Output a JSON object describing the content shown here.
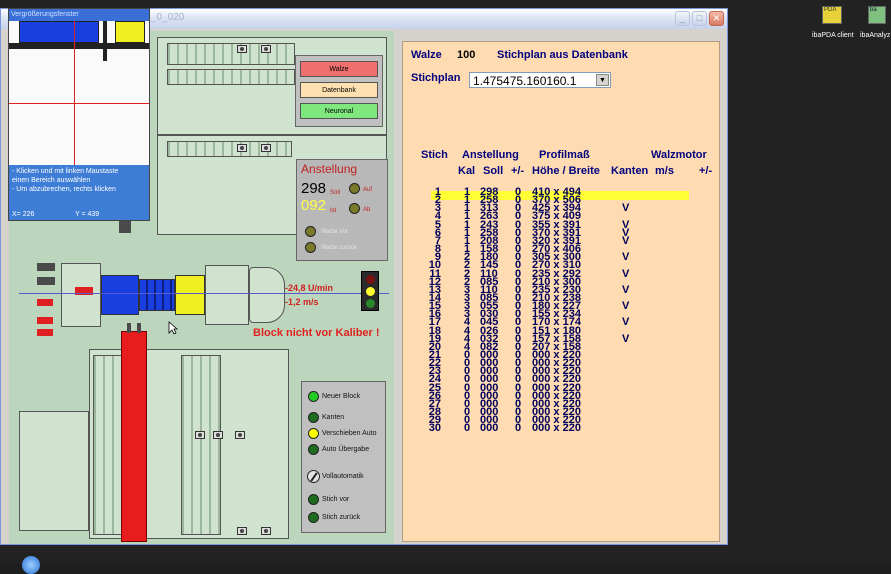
{
  "window": {
    "title": "_0_020",
    "minimize_glyph": "_",
    "maximize_glyph": "□",
    "close_glyph": "✕"
  },
  "magnifier": {
    "title": "Vergrößerungsfenster",
    "instructions": [
      "- Klicken und mit linken Maustaste",
      "  einen Bereich auswählen",
      "- Um abzubrechen, rechts klicken"
    ],
    "x_readout": "X= 226",
    "y_readout": "Y = 439"
  },
  "mode_buttons": {
    "walze": "Walze",
    "datenbank": "Datenbank",
    "neuronal": "Neuronal",
    "colors": {
      "walze": "#ef6f6f",
      "datenbank": "#ffe0b0",
      "neuronal": "#7ee87e"
    }
  },
  "anstellung": {
    "title": "Anstellung",
    "soll_value": "298",
    "soll_label": "Soll",
    "auf_label": "Auf",
    "ist_value": "092",
    "ist_label": "Ist",
    "ab_label": "Ab",
    "walze_vor": "Walze Vor",
    "walze_zurueck": "Walze zurück"
  },
  "mill": {
    "speed": "-24,8 U/min",
    "velocity": "-1,2 m/s",
    "warning": "Block nicht vor Kaliber !"
  },
  "controls": [
    {
      "label": "Neuer Block",
      "color": "#22cc22"
    },
    {
      "label": "Kanten",
      "color": "#1f6b1f"
    },
    {
      "label": "Verschieben Auto",
      "color": "#ffff00"
    },
    {
      "label": "Auto Übergabe",
      "color": "#1f6b1f"
    },
    {
      "label": "Vollautomatik",
      "color": "#888888"
    },
    {
      "label": "Stich vor",
      "color": "#1f6b1f"
    },
    {
      "label": "Stich zurück",
      "color": "#1f6b1f"
    }
  ],
  "plan": {
    "walze_label": "Walze",
    "walze_value": "100",
    "source": "Stichplan aus Datenbank",
    "stichplan_label": "Stichplan",
    "stichplan_value": "1.475475.160160.1",
    "headers": {
      "stich": "Stich",
      "anstellung": "Anstellung",
      "kal": "Kal",
      "soll": "Soll",
      "plusminus": "+/-",
      "profilmass": "Profilmaß",
      "hoehe_breite": "Höhe / Breite",
      "walzmotor": "Walzmotor",
      "kanten": "Kanten",
      "ms": "m/s",
      "motor_plusminus": "+/-"
    },
    "rows": [
      {
        "stich": "1",
        "kal": "1",
        "soll": "298",
        "pm": "0",
        "profil": "410 x 494",
        "kanten": ""
      },
      {
        "stich": "2",
        "kal": "1",
        "soll": "258",
        "pm": "0",
        "profil": "370 x 506",
        "kanten": ""
      },
      {
        "stich": "3",
        "kal": "1",
        "soll": "313",
        "pm": "0",
        "profil": "425 x 394",
        "kanten": "V"
      },
      {
        "stich": "4",
        "kal": "1",
        "soll": "263",
        "pm": "0",
        "profil": "375 x 409",
        "kanten": ""
      },
      {
        "stich": "5",
        "kal": "1",
        "soll": "243",
        "pm": "0",
        "profil": "355 x 391",
        "kanten": "V"
      },
      {
        "stich": "6",
        "kal": "1",
        "soll": "258",
        "pm": "0",
        "profil": "370 x 391",
        "kanten": "V"
      },
      {
        "stich": "7",
        "kal": "1",
        "soll": "208",
        "pm": "0",
        "profil": "320 x 391",
        "kanten": "V"
      },
      {
        "stich": "8",
        "kal": "1",
        "soll": "158",
        "pm": "0",
        "profil": "270 x 406",
        "kanten": ""
      },
      {
        "stich": "9",
        "kal": "2",
        "soll": "180",
        "pm": "0",
        "profil": "305 x 300",
        "kanten": "V"
      },
      {
        "stich": "10",
        "kal": "2",
        "soll": "145",
        "pm": "0",
        "profil": "270 x 310",
        "kanten": ""
      },
      {
        "stich": "11",
        "kal": "2",
        "soll": "110",
        "pm": "0",
        "profil": "235 x 292",
        "kanten": "V"
      },
      {
        "stich": "12",
        "kal": "2",
        "soll": "085",
        "pm": "0",
        "profil": "210 x 300",
        "kanten": ""
      },
      {
        "stich": "13",
        "kal": "3",
        "soll": "110",
        "pm": "0",
        "profil": "235 x 230",
        "kanten": "V"
      },
      {
        "stich": "14",
        "kal": "3",
        "soll": "085",
        "pm": "0",
        "profil": "210 x 238",
        "kanten": ""
      },
      {
        "stich": "15",
        "kal": "3",
        "soll": "055",
        "pm": "0",
        "profil": "180 x 227",
        "kanten": "V"
      },
      {
        "stich": "16",
        "kal": "3",
        "soll": "030",
        "pm": "0",
        "profil": "155 x 234",
        "kanten": ""
      },
      {
        "stich": "17",
        "kal": "4",
        "soll": "045",
        "pm": "0",
        "profil": "170 x 174",
        "kanten": "V"
      },
      {
        "stich": "18",
        "kal": "4",
        "soll": "026",
        "pm": "0",
        "profil": "151 x 180",
        "kanten": ""
      },
      {
        "stich": "19",
        "kal": "4",
        "soll": "032",
        "pm": "0",
        "profil": "157 x 158",
        "kanten": "V"
      },
      {
        "stich": "20",
        "kal": "4",
        "soll": "082",
        "pm": "0",
        "profil": "207 x 158",
        "kanten": ""
      },
      {
        "stich": "21",
        "kal": "0",
        "soll": "000",
        "pm": "0",
        "profil": "000 x 220",
        "kanten": ""
      },
      {
        "stich": "22",
        "kal": "0",
        "soll": "000",
        "pm": "0",
        "profil": "000 x 220",
        "kanten": ""
      },
      {
        "stich": "23",
        "kal": "0",
        "soll": "000",
        "pm": "0",
        "profil": "000 x 220",
        "kanten": ""
      },
      {
        "stich": "24",
        "kal": "0",
        "soll": "000",
        "pm": "0",
        "profil": "000 x 220",
        "kanten": ""
      },
      {
        "stich": "25",
        "kal": "0",
        "soll": "000",
        "pm": "0",
        "profil": "000 x 220",
        "kanten": ""
      },
      {
        "stich": "26",
        "kal": "0",
        "soll": "000",
        "pm": "0",
        "profil": "000 x 220",
        "kanten": ""
      },
      {
        "stich": "27",
        "kal": "0",
        "soll": "000",
        "pm": "0",
        "profil": "000 x 220",
        "kanten": ""
      },
      {
        "stich": "28",
        "kal": "0",
        "soll": "000",
        "pm": "0",
        "profil": "000 x 220",
        "kanten": ""
      },
      {
        "stich": "29",
        "kal": "0",
        "soll": "000",
        "pm": "0",
        "profil": "000 x 220",
        "kanten": ""
      },
      {
        "stich": "30",
        "kal": "0",
        "soll": "000",
        "pm": "0",
        "profil": "000 x 220",
        "kanten": ""
      }
    ]
  },
  "desktop_icons": [
    {
      "label": "ibaPDA client",
      "badge": "PDA",
      "icon": "ibapda-icon"
    },
    {
      "label": "ibaAnalyz",
      "badge": "ba",
      "icon": "ibaanalyzer-icon"
    }
  ]
}
